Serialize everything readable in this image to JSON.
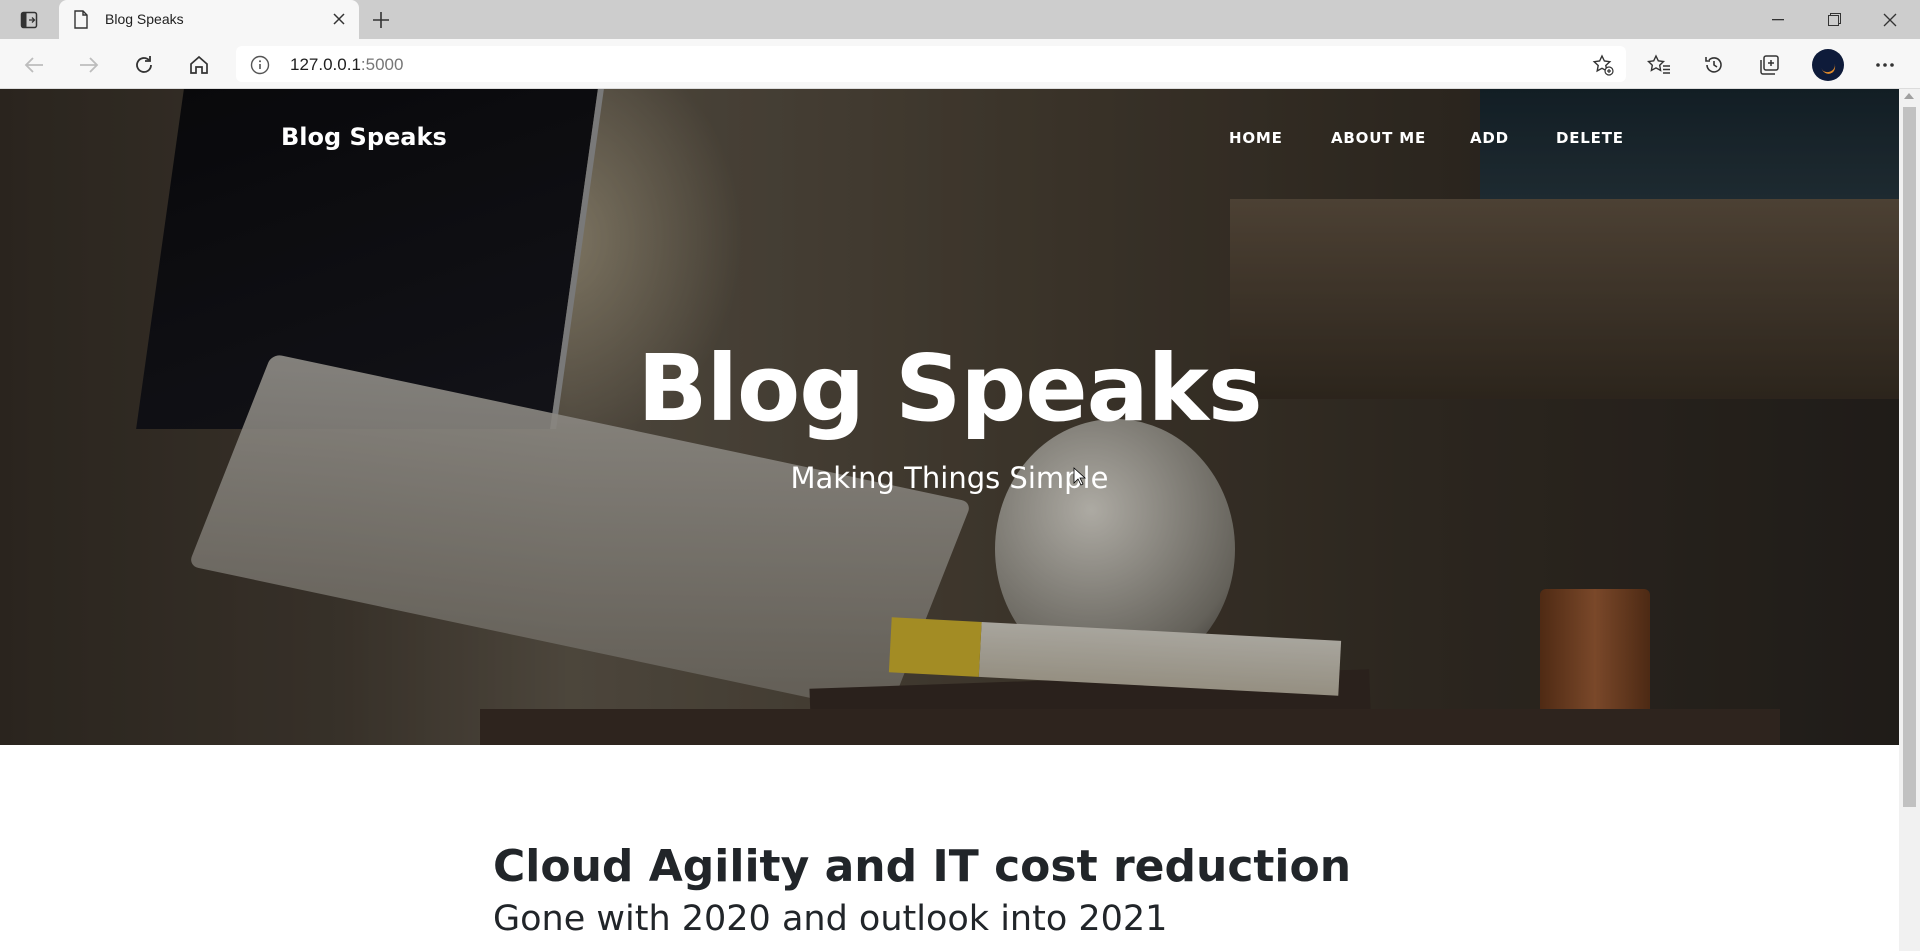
{
  "browser": {
    "tab_title": "Blog Speaks",
    "url_host": "127.0.0.1",
    "url_port": ":5000"
  },
  "icons": {
    "tab_actions": "tab-actions-icon",
    "favicon": "page-icon",
    "close_tab": "close-icon",
    "new_tab": "plus-icon",
    "minimize": "minimize-icon",
    "restore": "restore-icon",
    "close_window": "close-icon",
    "back": "back-arrow-icon",
    "forward": "forward-arrow-icon",
    "refresh": "refresh-icon",
    "home": "home-icon",
    "site_info": "info-icon",
    "add_favorite": "star-plus-icon",
    "favorites": "favorites-icon",
    "history": "history-icon",
    "collections": "collections-icon",
    "profile": "profile-avatar",
    "more": "more-icon"
  },
  "site": {
    "brand": "Blog Speaks",
    "nav": [
      "HOME",
      "ABOUT ME",
      "ADD",
      "DELETE"
    ]
  },
  "hero": {
    "title": "Blog Speaks",
    "subtitle": "Making Things Simple"
  },
  "post": {
    "title": "Cloud Agility and IT cost reduction",
    "subtitle": "Gone with 2020 and outlook into 2021"
  }
}
